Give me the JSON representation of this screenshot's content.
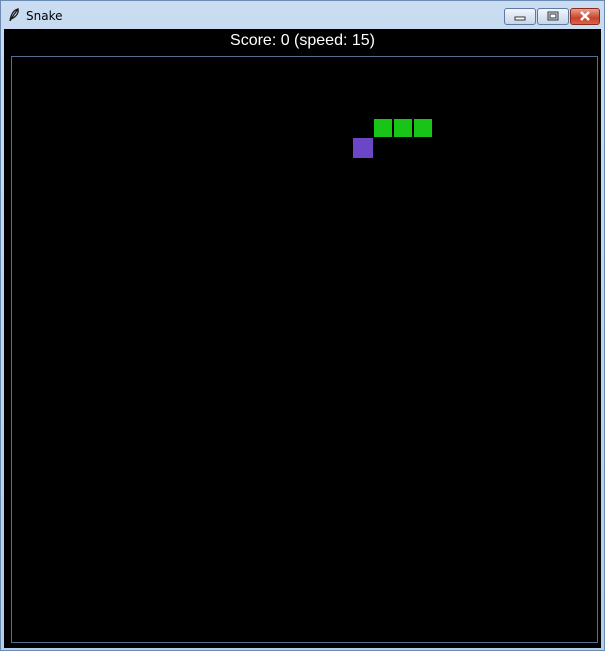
{
  "window": {
    "title": "Snake",
    "app_icon": "feather-icon",
    "controls": [
      "minimize-icon",
      "maximize-icon",
      "close-icon"
    ]
  },
  "hud": {
    "score_text": "Score: 0 (speed: 15)",
    "score": 0,
    "speed": 15
  },
  "colors": {
    "board_background": "#000000",
    "snake": "#18c418",
    "food": "#6b46c6",
    "text": "#ffffff"
  },
  "game": {
    "cell_grid": "20px",
    "snake": [
      [
        18,
        3
      ],
      [
        19,
        3
      ],
      [
        20,
        3
      ]
    ],
    "food": [
      17,
      4
    ]
  }
}
